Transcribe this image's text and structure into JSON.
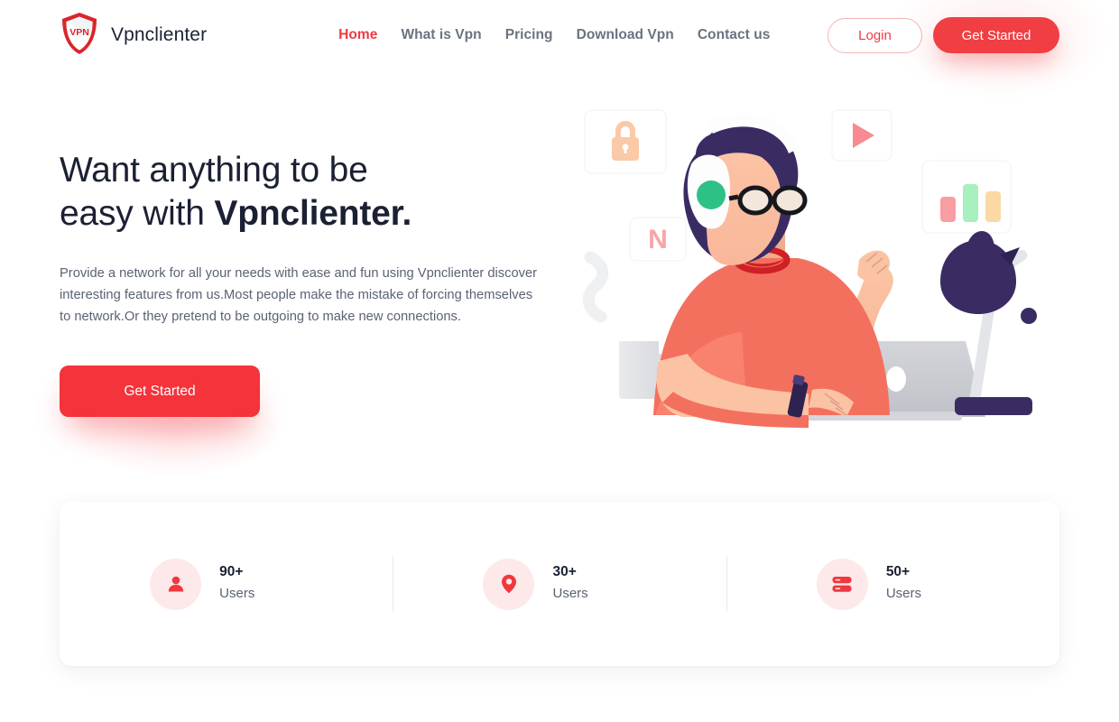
{
  "brand": {
    "name": "Vpnclienter",
    "logo_icon": "vpn-shield-icon",
    "logo_text": "VPN"
  },
  "nav": {
    "items": [
      {
        "label": "Home",
        "active": true
      },
      {
        "label": "What is Vpn",
        "active": false
      },
      {
        "label": "Pricing",
        "active": false
      },
      {
        "label": "Download Vpn",
        "active": false
      },
      {
        "label": "Contact us",
        "active": false
      }
    ]
  },
  "auth": {
    "login_label": "Login",
    "get_started_label": "Get Started"
  },
  "hero": {
    "title_line1": "Want anything to be",
    "title_line2_normal": "easy with ",
    "title_line2_bold": "Vpnclienter.",
    "description": "Provide a network for all your needs with ease and fun using Vpnclienter discover interesting features from us.Most people make the mistake of forcing themselves to network.Or they pretend to be outgoing to make new connections.",
    "cta_label": "Get Started"
  },
  "illustration": {
    "cards": [
      {
        "icon": "lock-icon",
        "name": "lock-card"
      },
      {
        "icon": "netflix-n-icon",
        "name": "n-card",
        "text": "N"
      },
      {
        "icon": "play-icon",
        "name": "play-card"
      },
      {
        "icon": "bar-chart-icon",
        "name": "chart-card"
      }
    ],
    "objects": [
      "coffee-mug",
      "woman-with-headphones",
      "laptop",
      "desk-lamp"
    ]
  },
  "stats": {
    "items": [
      {
        "icon": "user-icon",
        "value": "90+",
        "label": "Users"
      },
      {
        "icon": "location-pin-icon",
        "value": "30+",
        "label": "Users"
      },
      {
        "icon": "server-stack-icon",
        "value": "50+",
        "label": "Users"
      }
    ]
  },
  "colors": {
    "accent_red": "#f0383f",
    "nav_active": "#ef3b42",
    "heading": "#1b2033",
    "body_text": "#5a6274",
    "icon_bg_pink": "#fde9e9",
    "illus_purple": "#3a2c63",
    "illus_coral": "#f4705e",
    "illus_skin": "#fbbfa1",
    "illus_green": "#2ec185"
  }
}
